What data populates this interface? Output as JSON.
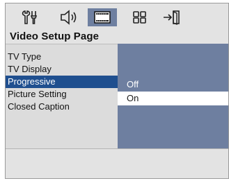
{
  "tabs": [
    {
      "icon": "tools-icon",
      "active": false
    },
    {
      "icon": "speaker-icon",
      "active": false
    },
    {
      "icon": "video-screen-icon",
      "active": true
    },
    {
      "icon": "grid-icon",
      "active": false
    },
    {
      "icon": "exit-door-icon",
      "active": false
    }
  ],
  "page_title": "Video Setup Page",
  "menu": {
    "items": [
      "TV Type",
      "TV Display",
      "Progressive",
      "Picture Setting",
      "Closed Caption"
    ],
    "selected_index": 2
  },
  "submenu": {
    "items": [
      "Off",
      "On"
    ],
    "selected_index": 1
  },
  "colors": {
    "background": "#e3e3e3",
    "panel": "#6e7fa0",
    "highlight": "#1f4f8f"
  }
}
